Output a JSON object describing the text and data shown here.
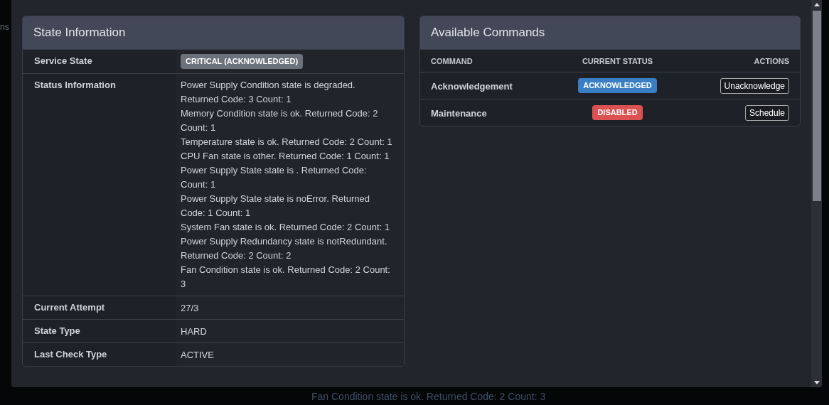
{
  "background": {
    "edge_text": "ns",
    "footer_text": "Fan Condition state is ok. Returned Code: 2 Count: 3"
  },
  "state_information": {
    "title": "State Information",
    "rows": [
      {
        "kind": "badge",
        "label": "Service State",
        "value": "CRITICAL (ACKNOWLEDGED)"
      },
      {
        "kind": "messages",
        "label": "Status Information",
        "messages": [
          "Power Supply Condition state is degraded. Returned Code: 3 Count: 1",
          "Memory Condition state is ok. Returned Code: 2 Count: 1",
          "Temperature state is ok. Returned Code: 2 Count: 1",
          "CPU Fan state is other. Returned Code: 1 Count: 1",
          "Power Supply State state is . Returned Code: Count: 1",
          "Power Supply State state is noError. Returned Code: 1 Count: 1",
          "System Fan state is ok. Returned Code: 2 Count: 1",
          "Power Supply Redundancy state is notRedundant. Returned Code: 2 Count: 2",
          "Fan Condition state is ok. Returned Code: 2 Count: 3"
        ]
      },
      {
        "kind": "text",
        "label": "Current Attempt",
        "value": "27/3"
      },
      {
        "kind": "text",
        "label": "State Type",
        "value": "HARD"
      },
      {
        "kind": "text",
        "label": "Last Check Type",
        "value": "ACTIVE"
      }
    ]
  },
  "available_commands": {
    "title": "Available Commands",
    "columns": [
      "COMMAND",
      "CURRENT STATUS",
      "ACTIONS"
    ],
    "rows": [
      {
        "command": "Acknowledgement",
        "status": "ACKNOWLEDGED",
        "color": "#3a7fc4",
        "action": "Unacknowledge"
      },
      {
        "command": "Maintenance",
        "status": "DISABLED",
        "color": "#dc5151",
        "action": "Schedule"
      }
    ]
  }
}
